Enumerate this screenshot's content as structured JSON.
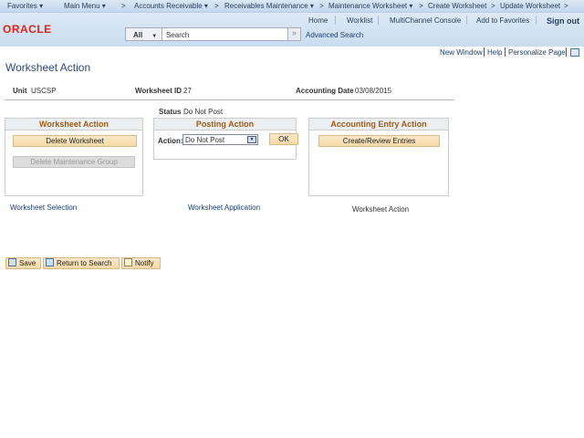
{
  "nav": {
    "items": [
      "Favorites ▾",
      "Main Menu ▾",
      "Accounts Receivable ▾",
      "Receivables Maintenance ▾",
      "Maintenance Worksheet ▾",
      "Create Worksheet",
      "Update Worksheet"
    ],
    "separator": ">"
  },
  "header": {
    "links": [
      "Home",
      "Worklist",
      "MultiChannel Console",
      "Add to Favorites"
    ],
    "sign_out": "Sign out",
    "logo": "ORACLE",
    "search_scope": "All",
    "search_placeholder": "Search",
    "advanced_search": "Advanced Search"
  },
  "toplinks": {
    "new_window": "New Window",
    "help": "Help",
    "personalize": "Personalize Page"
  },
  "page": {
    "title": "Worksheet Action",
    "unit_label": "Unit",
    "unit": "USCSP",
    "ws_id_label": "Worksheet ID",
    "ws_id": "27",
    "acct_date_label": "Accounting Date",
    "acct_date": "03/08/2015",
    "status_label": "Status",
    "status": "Do Not Post"
  },
  "ws_action": {
    "title": "Worksheet Action",
    "delete": "Delete Worksheet",
    "delete_group": "Delete Maintenance Group"
  },
  "posting": {
    "title": "Posting Action",
    "action_label": "Action:",
    "action_value": "Do Not Post",
    "ok": "OK"
  },
  "acct": {
    "title": "Accounting Entry Action",
    "create": "Create/Review Entries"
  },
  "tabs": {
    "selection_a": "Worksheet ",
    "selection_b": "Selection",
    "application_a": "Worksheet ",
    "application_b": "Application",
    "action": "Worksheet Action"
  },
  "footer": {
    "save": "Save",
    "return": "Return to Search",
    "notify": "Notify"
  }
}
